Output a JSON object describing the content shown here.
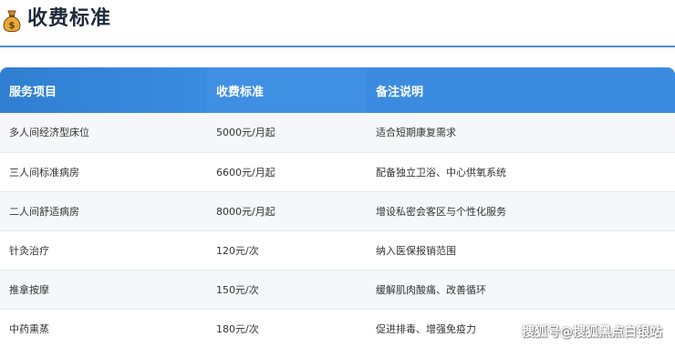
{
  "section": {
    "icon": "money-bag-icon",
    "title": "收费标准"
  },
  "table": {
    "headers": [
      "服务项目",
      "收费标准",
      "备注说明"
    ],
    "rows": [
      [
        "多人间经济型床位",
        "5000元/月起",
        "适合短期康复需求"
      ],
      [
        "三人间标准病房",
        "6600元/月起",
        "配备独立卫浴、中心供氧系统"
      ],
      [
        "二人间舒适病房",
        "8000元/月起",
        "增设私密会客区与个性化服务"
      ],
      [
        "针灸治疗",
        "120元/次",
        "纳入医保报销范围"
      ],
      [
        "推拿按摩",
        "150元/次",
        "缓解肌肉酸痛、改善循环"
      ],
      [
        "中药熏蒸",
        "180元/次",
        "促进排毒、增强免疫力"
      ]
    ]
  },
  "watermark": "搜狐号@搜狐黑点白银站",
  "colors": {
    "header_bg": "#3a8ce0",
    "divider": "#4a90d9",
    "row_alt": "#f5f7fa"
  }
}
